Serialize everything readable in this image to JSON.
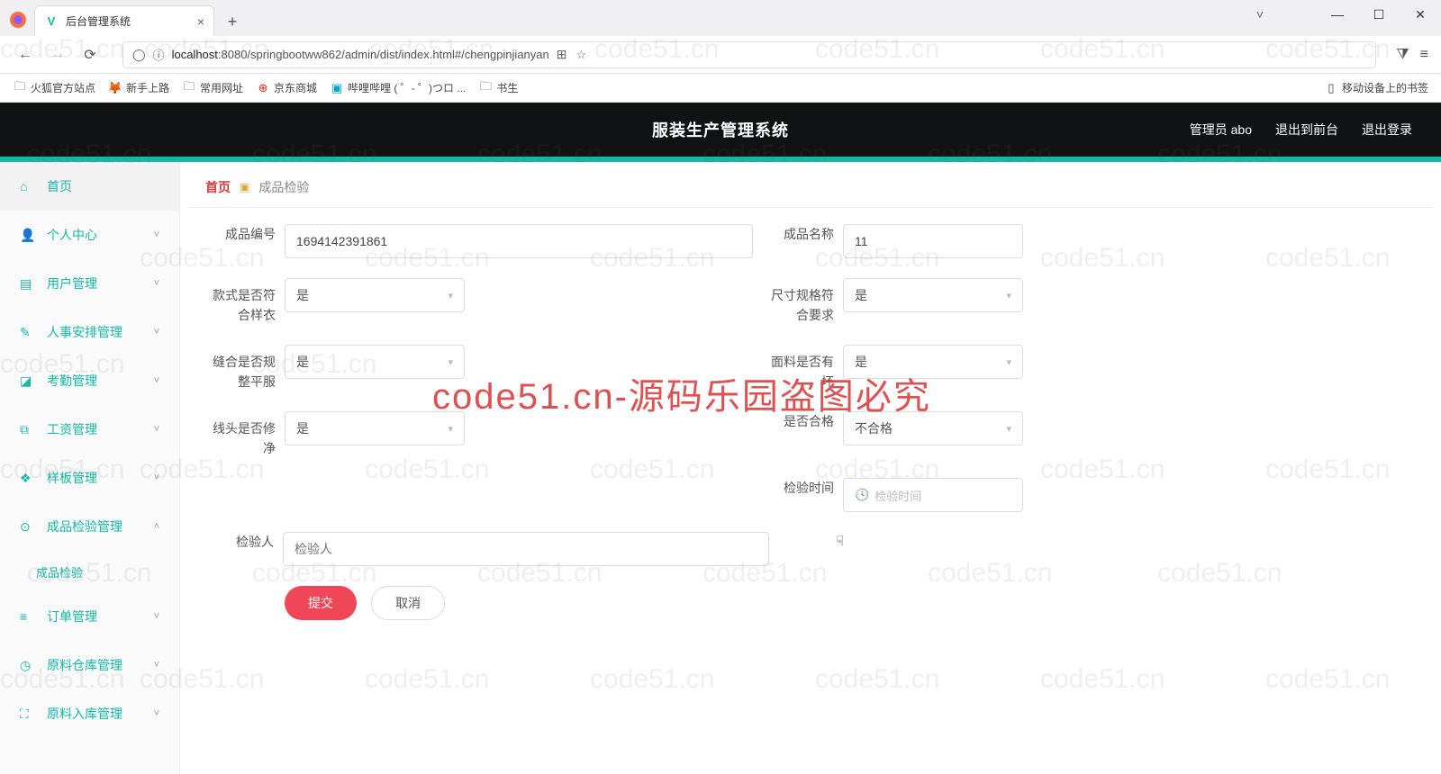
{
  "browser": {
    "tab_title": "后台管理系统",
    "url_host": "localhost",
    "url_path": ":8080/springbootww862/admin/dist/index.html#/chengpinjianyan",
    "bookmarks": [
      "火狐官方站点",
      "新手上路",
      "常用网址",
      "京东商城",
      "哔哩哔哩 ( ゜- ゜)つロ ...",
      "书生"
    ],
    "mobile_bm": "移动设备上的书签"
  },
  "header": {
    "title": "服装生产管理系统",
    "user": "管理员 abo",
    "back": "退出到前台",
    "logout": "退出登录"
  },
  "sidebar": {
    "items": [
      {
        "label": "首页",
        "icon": "⌂",
        "kind": "home"
      },
      {
        "label": "个人中心",
        "icon": "👤",
        "arrow": "˅"
      },
      {
        "label": "用户管理",
        "icon": "▤",
        "arrow": "˅"
      },
      {
        "label": "人事安排管理",
        "icon": "✎",
        "arrow": "˅"
      },
      {
        "label": "考勤管理",
        "icon": "◪",
        "arrow": "˅"
      },
      {
        "label": "工资管理",
        "icon": "⧉",
        "arrow": "˅"
      },
      {
        "label": "样板管理",
        "icon": "❖",
        "arrow": "˅"
      },
      {
        "label": "成品检验管理",
        "icon": "⊙",
        "arrow": "˄",
        "open": true,
        "sub": "成品检验"
      },
      {
        "label": "订单管理",
        "icon": "≡",
        "arrow": "˅"
      },
      {
        "label": "原料仓库管理",
        "icon": "◷",
        "arrow": "˅"
      },
      {
        "label": "原料入库管理",
        "icon": "⛶",
        "arrow": "˅"
      }
    ]
  },
  "breadcrumb": {
    "home": "首页",
    "current": "成品检验"
  },
  "form": {
    "cpbh_label": "成品编号",
    "cpbh_value": "1694142391861",
    "cpmc_label": "成品名称",
    "cpmc_value": "11",
    "ksfh_label": "款式是否符合样衣",
    "ksfh_value": "是",
    "ccgg_label": "尺寸规格符合要求",
    "ccgg_value": "是",
    "fhgz_label": "缝合是否规整平服",
    "fhgz_value": "是",
    "mlyh_label": "面料是否有坏",
    "mlyh_value": "是",
    "xtxj_label": "线头是否修净",
    "xtxj_value": "是",
    "sfhg_label": "是否合格",
    "sfhg_value": "不合格",
    "jysj_label": "检验时间",
    "jysj_placeholder": "检验时间",
    "jyr_label": "检验人",
    "jyr_placeholder": "检验人",
    "submit": "提交",
    "cancel": "取消"
  },
  "watermark_text": "code51.cn",
  "watermark_big": "code51.cn-源码乐园盗图必究"
}
